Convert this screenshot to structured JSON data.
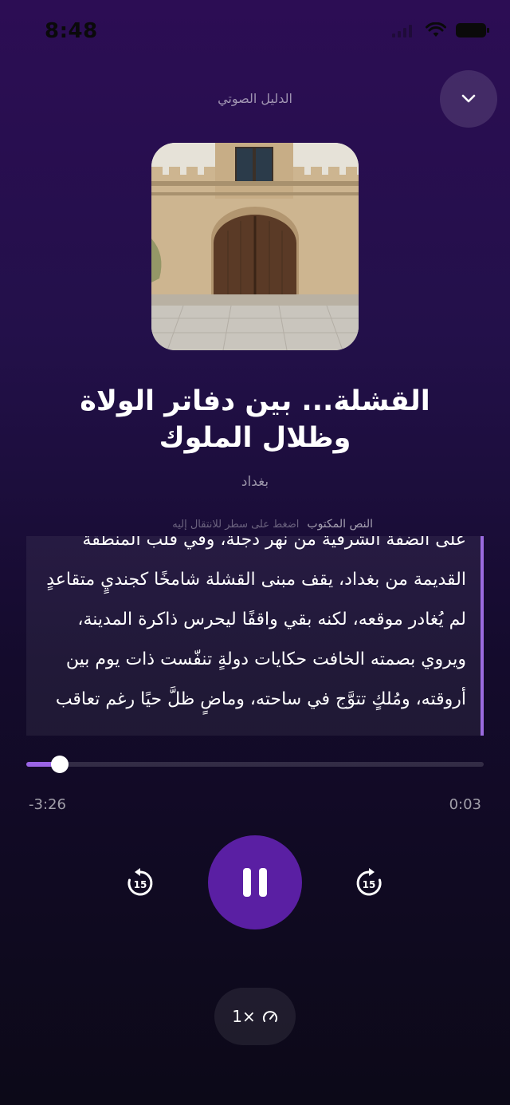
{
  "status_bar": {
    "time": "8:48"
  },
  "header": {
    "title": "الدليل الصوتي",
    "collapse_icon": "chevron-down-icon"
  },
  "track": {
    "title": "القشلة... بين دفاتر الولاة وظلال الملوك",
    "subtitle": "بغداد"
  },
  "transcript": {
    "label": "النص المكتوب",
    "hint": "اضغط على سطر للانتقال إليه",
    "text": "على الضفة الشرقية من نهر دجلة، وفي قلب المنطقة القديمة من بغداد، يقف مبنى القشلة شامخًا كجنديٍ متقاعدٍ لم يُغادر موقعه، لكنه بقي واقفًا ليحرس ذاكرة المدينة، ويروي بصمته الخافت حكايات دولةٍ تنفّست ذات يوم بين أروقته، ومُلكٍ تتوَّج في ساحته، وماضٍ ظلَّ حيًا رغم تعاقب"
  },
  "player": {
    "elapsed": "0:03",
    "remaining": "-3:26",
    "progress_fraction": 0.073,
    "skip_back_seconds": "15",
    "skip_forward_seconds": "15",
    "accent_color": "#5a1fa3"
  },
  "speed": {
    "label": "1×",
    "icon": "speedometer-icon"
  }
}
